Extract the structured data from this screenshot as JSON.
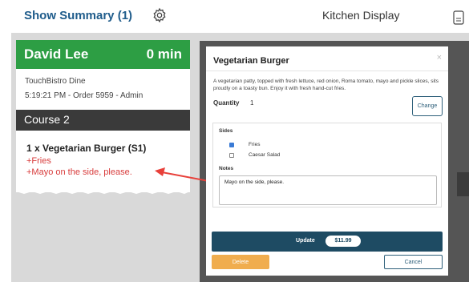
{
  "header": {
    "show_summary": "Show Summary (1)",
    "title": "Kitchen Display",
    "settings_icon": "gear-icon",
    "summary_icon": "document-icon"
  },
  "ticket": {
    "customer": "David Lee",
    "elapsed": "0 min",
    "venue": "TouchBistro Dine",
    "order_info": "5:19:21 PM - Order 5959 - Admin",
    "course": "Course 2",
    "item": "1 x Vegetarian Burger (S1)",
    "modifiers": [
      "+Fries",
      "+Mayo on the side, please."
    ],
    "header_color": "#2d9e44",
    "modifier_color": "#d83b3b"
  },
  "modal": {
    "title": "Vegetarian Burger",
    "close_glyph": "×",
    "description": "A vegetarian patty, topped with fresh lettuce, red onion, Roma tomato, mayo and pickle slices, sits proudly on a toasty bun. Enjoy it with fresh hand-cut fries.",
    "quantity_label": "Quantity",
    "quantity_value": "1",
    "change_label": "Change",
    "sides_label": "Sides",
    "sides": [
      {
        "label": "Fries",
        "checked": true
      },
      {
        "label": "Caesar Salad",
        "checked": false
      }
    ],
    "notes_label": "Notes",
    "notes_value": "Mayo on the side, please.",
    "update_label": "Update",
    "price": "$11.99",
    "delete_label": "Delete",
    "cancel_label": "Cancel",
    "update_color": "#1e4b63",
    "delete_color": "#f0ad4e"
  },
  "annotation": {
    "arrow_color": "#e8403a"
  }
}
